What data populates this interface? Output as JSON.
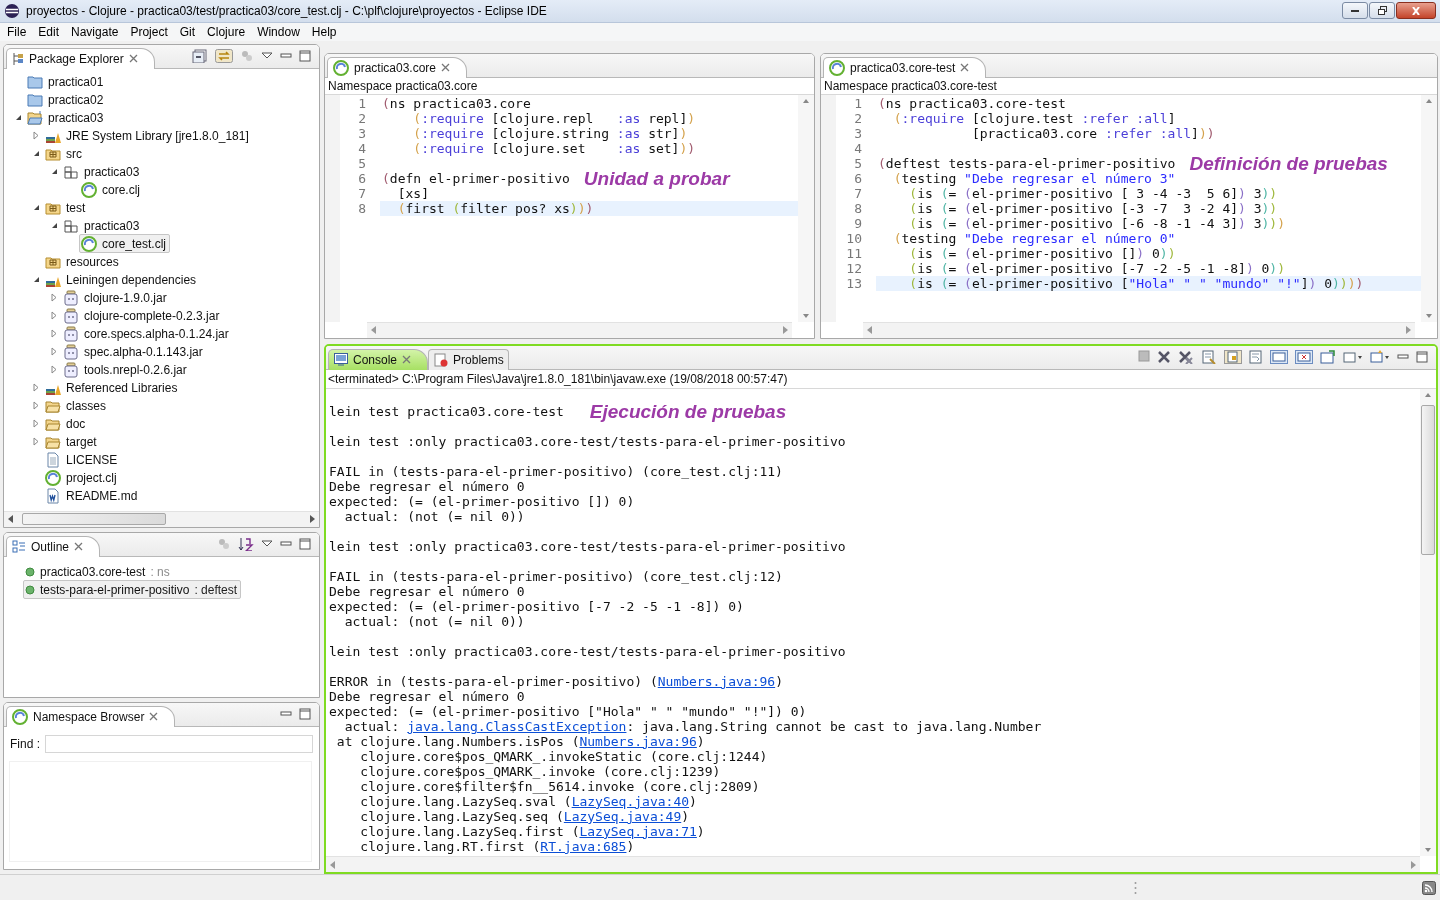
{
  "window": {
    "title": "proyectos - Clojure - practica03/test/practica03/core_test.clj - C:\\plf\\clojure\\proyectos - Eclipse IDE"
  },
  "menu": [
    "File",
    "Edit",
    "Navigate",
    "Project",
    "Git",
    "Clojure",
    "Window",
    "Help"
  ],
  "package_explorer": {
    "tab": "Package Explorer",
    "active": false,
    "tree": [
      {
        "label": "practica01",
        "kind": "project",
        "selected": false
      },
      {
        "label": "practica02",
        "kind": "project",
        "selected": false
      },
      {
        "label": "practica03",
        "kind": "java-project",
        "selected": false,
        "expanded": true,
        "children": [
          {
            "label": "JRE System Library [jre1.8.0_181]",
            "kind": "library",
            "selected": false,
            "expanded": false
          },
          {
            "label": "src",
            "kind": "source-folder",
            "selected": false,
            "expanded": true,
            "children": [
              {
                "label": "practica03",
                "kind": "package",
                "selected": false,
                "expanded": true,
                "children": [
                  {
                    "label": "core.clj",
                    "kind": "clj",
                    "selected": false
                  }
                ]
              }
            ]
          },
          {
            "label": "test",
            "kind": "source-folder",
            "selected": false,
            "expanded": true,
            "children": [
              {
                "label": "practica03",
                "kind": "package",
                "selected": false,
                "expanded": true,
                "children": [
                  {
                    "label": "core_test.clj",
                    "kind": "clj",
                    "selected": true
                  }
                ]
              }
            ]
          },
          {
            "label": "resources",
            "kind": "source-folder",
            "selected": false
          },
          {
            "label": "Leiningen dependencies",
            "kind": "library",
            "selected": false,
            "expanded": true,
            "children": [
              {
                "label": "clojure-1.9.0.jar",
                "kind": "jar",
                "selected": false,
                "expanded": false
              },
              {
                "label": "clojure-complete-0.2.3.jar",
                "kind": "jar",
                "selected": false,
                "expanded": false
              },
              {
                "label": "core.specs.alpha-0.1.24.jar",
                "kind": "jar",
                "selected": false,
                "expanded": false
              },
              {
                "label": "spec.alpha-0.1.143.jar",
                "kind": "jar",
                "selected": false,
                "expanded": false
              },
              {
                "label": "tools.nrepl-0.2.6.jar",
                "kind": "jar",
                "selected": false,
                "expanded": false
              }
            ]
          },
          {
            "label": "Referenced Libraries",
            "kind": "library",
            "selected": false,
            "expanded": false
          },
          {
            "label": "classes",
            "kind": "folder",
            "selected": false,
            "expanded": false
          },
          {
            "label": "doc",
            "kind": "folder",
            "selected": false,
            "expanded": false
          },
          {
            "label": "target",
            "kind": "folder",
            "selected": false,
            "expanded": false
          },
          {
            "label": "LICENSE",
            "kind": "file",
            "selected": false
          },
          {
            "label": "project.clj",
            "kind": "clj",
            "selected": false
          },
          {
            "label": "README.md",
            "kind": "word-file",
            "selected": false
          }
        ]
      }
    ]
  },
  "outline": {
    "tab": "Outline",
    "active": false,
    "items": [
      {
        "label": "practica03.core-test",
        "detail": ": ns",
        "selected": false
      },
      {
        "label": "tests-para-el-primer-positivo",
        "detail": ": deftest",
        "selected": true
      }
    ]
  },
  "namespace_browser": {
    "tab": "Namespace Browser",
    "active": false,
    "find_label": "Find :"
  },
  "editors": [
    {
      "tab": "practica03.core",
      "namespace": "Namespace practica03.core",
      "lines": [
        {
          "n": "1",
          "code": "(ns practica03.core",
          "current": false
        },
        {
          "n": "2",
          "code": "    (:require [clojure.repl   :as repl])",
          "current": false
        },
        {
          "n": "3",
          "code": "    (:require [clojure.string :as str])",
          "current": false
        },
        {
          "n": "4",
          "code": "    (:require [clojure.set    :as set]))",
          "current": false
        },
        {
          "n": "5",
          "current": false
        },
        {
          "n": "6",
          "code": "(defn el-primer-positivo",
          "note": "Unidad a probar",
          "current": false
        },
        {
          "n": "7",
          "code": "  [xs]",
          "current": false
        },
        {
          "n": "8",
          "code": "  (first (filter pos? xs)))",
          "current": true
        }
      ]
    },
    {
      "tab": "practica03.core-test",
      "namespace": "Namespace practica03.core-test",
      "lines": [
        {
          "n": "1",
          "code": "(ns practica03.core-test",
          "current": false
        },
        {
          "n": "2",
          "code": "  (:require [clojure.test :refer :all]",
          "current": false
        },
        {
          "n": "3",
          "code": "            [practica03.core :refer :all]))",
          "current": false
        },
        {
          "n": "4",
          "current": false
        },
        {
          "n": "5",
          "code": "(deftest tests-para-el-primer-positivo",
          "note": "Definición de pruebas",
          "current": false
        },
        {
          "n": "6",
          "code": "  (testing \"Debe regresar el número 3\"",
          "current": false
        },
        {
          "n": "7",
          "code": "    (is (= (el-primer-positivo [ 3 -4 -3  5 6]) 3))",
          "current": false
        },
        {
          "n": "8",
          "code": "    (is (= (el-primer-positivo [-3 -7  3 -2 4]) 3))",
          "current": false
        },
        {
          "n": "9",
          "code": "    (is (= (el-primer-positivo [-6 -8 -1 -4 3]) 3)))",
          "current": false
        },
        {
          "n": "10",
          "code": "  (testing \"Debe regresar el número 0\"",
          "current": false
        },
        {
          "n": "11",
          "code": "    (is (= (el-primer-positivo []) 0))",
          "current": false
        },
        {
          "n": "12",
          "code": "    (is (= (el-primer-positivo [-7 -2 -5 -1 -8]) 0))",
          "current": false
        },
        {
          "n": "13",
          "code": "    (is (= (el-primer-positivo [\"Hola\" \" \" \"mundo\" \"!\"]) 0))))",
          "current": true
        }
      ]
    }
  ],
  "console": {
    "active": true,
    "tabs": [
      {
        "label": "Console",
        "selected": true
      },
      {
        "label": "Problems",
        "selected": false
      }
    ],
    "process": "<terminated> C:\\Program Files\\Java\\jre1.8.0_181\\bin\\javaw.exe (19/08/2018 00:57:47)",
    "blocks": [
      [
        {
          "parts": [
            {
              "text": "lein test practica03.core-test"
            }
          ],
          "note": "Ejecución de pruebas"
        }
      ],
      [
        {
          "parts": [
            {
              "text": "lein test :only practica03.core-test/tests-para-el-primer-positivo"
            }
          ]
        }
      ],
      [
        {
          "parts": [
            {
              "text": "FAIL in (tests-para-el-primer-positivo) (core_test.clj:11)"
            }
          ]
        },
        {
          "parts": [
            {
              "text": "Debe regresar el número 0"
            }
          ]
        },
        {
          "parts": [
            {
              "text": "expected: (= (el-primer-positivo []) 0)"
            }
          ]
        },
        {
          "parts": [
            {
              "text": "  actual: (not (= nil 0))"
            }
          ]
        }
      ],
      [
        {
          "parts": [
            {
              "text": "lein test :only practica03.core-test/tests-para-el-primer-positivo"
            }
          ]
        }
      ],
      [
        {
          "parts": [
            {
              "text": "FAIL in (tests-para-el-primer-positivo) (core_test.clj:12)"
            }
          ]
        },
        {
          "parts": [
            {
              "text": "Debe regresar el número 0"
            }
          ]
        },
        {
          "parts": [
            {
              "text": "expected: (= (el-primer-positivo [-7 -2 -5 -1 -8]) 0)"
            }
          ]
        },
        {
          "parts": [
            {
              "text": "  actual: (not (= nil 0))"
            }
          ]
        }
      ],
      [
        {
          "parts": [
            {
              "text": "lein test :only practica03.core-test/tests-para-el-primer-positivo"
            }
          ]
        }
      ],
      [
        {
          "parts": [
            {
              "text": "ERROR in (tests-para-el-primer-positivo) ("
            },
            {
              "text": "Numbers.java:96",
              "kind": "link"
            },
            {
              "text": ")"
            }
          ]
        },
        {
          "parts": [
            {
              "text": "Debe regresar el número 0"
            }
          ]
        },
        {
          "parts": [
            {
              "text": "expected: (= (el-primer-positivo [\"Hola\" \" \" \"mundo\" \"!\"]) 0)"
            }
          ]
        },
        {
          "parts": [
            {
              "text": "  actual: "
            },
            {
              "text": "java.lang.ClassCastException",
              "kind": "link"
            },
            {
              "text": ": java.lang.String cannot be cast to java.lang.Number"
            }
          ]
        },
        {
          "parts": [
            {
              "text": " at clojure.lang.Numbers.isPos ("
            },
            {
              "text": "Numbers.java:96",
              "kind": "link"
            },
            {
              "text": ")"
            }
          ]
        },
        {
          "parts": [
            {
              "text": "    clojure.core$pos_QMARK_.invokeStatic (core.clj:1244)"
            }
          ]
        },
        {
          "parts": [
            {
              "text": "    clojure.core$pos_QMARK_.invoke (core.clj:1239)"
            }
          ]
        },
        {
          "parts": [
            {
              "text": "    clojure.core$filter$fn__5614.invoke (core.clj:2809)"
            }
          ]
        },
        {
          "parts": [
            {
              "text": "    clojure.lang.LazySeq.sval ("
            },
            {
              "text": "LazySeq.java:40",
              "kind": "link"
            },
            {
              "text": ")"
            }
          ]
        },
        {
          "parts": [
            {
              "text": "    clojure.lang.LazySeq.seq ("
            },
            {
              "text": "LazySeq.java:49",
              "kind": "link"
            },
            {
              "text": ")"
            }
          ]
        },
        {
          "parts": [
            {
              "text": "    clojure.lang.LazySeq.first ("
            },
            {
              "text": "LazySeq.java:71",
              "kind": "link"
            },
            {
              "text": ")"
            }
          ]
        },
        {
          "parts": [
            {
              "text": "    clojure.lang.RT.first ("
            },
            {
              "text": "RT.java:685",
              "kind": "link"
            },
            {
              "text": ")"
            }
          ]
        }
      ]
    ]
  }
}
